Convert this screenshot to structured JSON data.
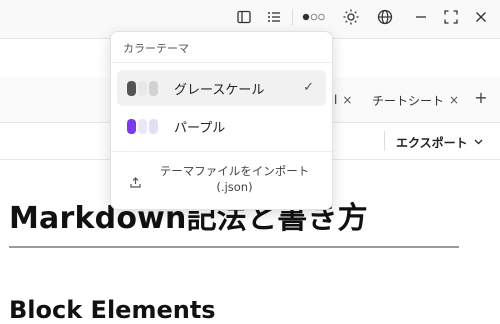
{
  "toolbar": {
    "icons": [
      "sidebar-icon",
      "outline-list-icon",
      "theme-dots-icon",
      "sun-icon",
      "globe-icon",
      "minimize-icon",
      "fullscreen-icon",
      "close-icon"
    ]
  },
  "tabs": [
    {
      "label": "l",
      "close": "×"
    },
    {
      "label": "チートシート",
      "close": "×"
    }
  ],
  "tab_add": "+",
  "export": {
    "label": "エクスポート",
    "chevron": "⌄"
  },
  "document": {
    "heading1": "Markdown記法と書き方",
    "heading2": "Block Elements"
  },
  "theme_menu": {
    "title": "カラーテーマ",
    "items": [
      {
        "label": "グレースケール",
        "selected": true,
        "swatches": [
          "#555555",
          "#e8e8e8",
          "#d2d2d2"
        ]
      },
      {
        "label": "パープル",
        "selected": false,
        "swatches": [
          "#7c3aed",
          "#ece6fb",
          "#e4ddf8"
        ]
      }
    ],
    "check": "✓",
    "import_label": "テーマファイルをインポート (.json)"
  }
}
